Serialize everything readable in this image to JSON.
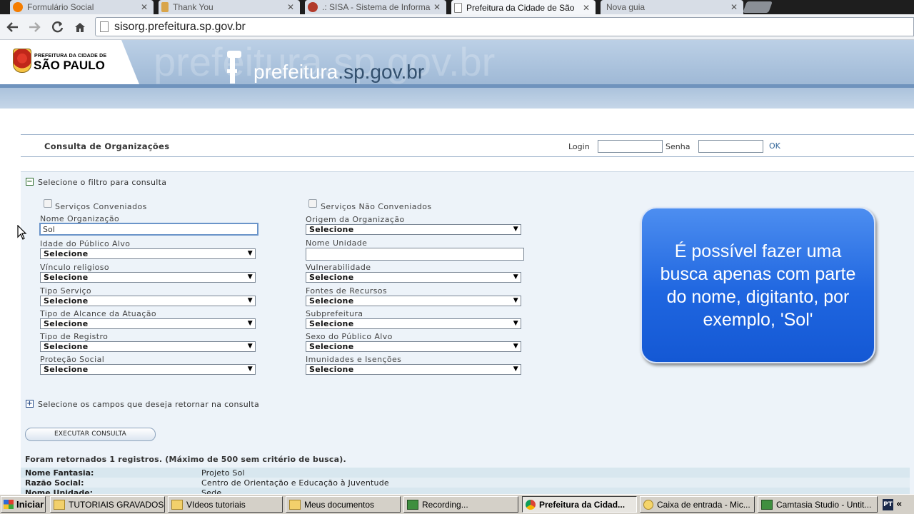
{
  "browser": {
    "tabs": [
      {
        "label": "Formulário Social",
        "active": false,
        "favicon": "blogger-icon",
        "color": "#f57d00"
      },
      {
        "label": "Thank You",
        "active": false,
        "favicon": "tool-icon",
        "color": "#d9a54a"
      },
      {
        "label": ".: SISA - Sistema de Informa",
        "active": false,
        "favicon": "sisa-icon",
        "color": "#b23a2a"
      },
      {
        "label": "Prefeitura da Cidade de São",
        "active": true,
        "favicon": "page-icon",
        "color": "#ffffff"
      },
      {
        "label": "Nova guia",
        "active": false,
        "favicon": "",
        "color": ""
      }
    ],
    "close_glyph": "✕",
    "url": "sisorg.prefeitura.sp.gov.br"
  },
  "site": {
    "logo_small": "PREFEITURA DA CIDADE DE",
    "logo_big": "SÃO PAULO",
    "watermark": "prefeitura.sp.gov.br",
    "title_main": "prefeitura",
    "title_domain": ".sp.gov.br"
  },
  "page": {
    "title": "Consulta de Organizações",
    "login_label": "Login",
    "password_label": "Senha",
    "ok_label": "OK"
  },
  "filter": {
    "collapse_glyph": "−",
    "expand_glyph": "+",
    "section_title": "Selecione o filtro para consulta",
    "checkbox_left": "Serviços Conveniados",
    "checkbox_right": "Serviços Não Conveniados",
    "left_fields": [
      {
        "label": "Nome Organização",
        "type": "text",
        "value": "Sol"
      },
      {
        "label": "Idade do Público Alvo",
        "type": "select",
        "value": "Selecione"
      },
      {
        "label": "Vínculo religioso",
        "type": "select",
        "value": "Selecione"
      },
      {
        "label": "Tipo Serviço",
        "type": "select",
        "value": "Selecione"
      },
      {
        "label": "Tipo de Alcance da Atuação",
        "type": "select",
        "value": "Selecione"
      },
      {
        "label": "Tipo de Registro",
        "type": "select",
        "value": "Selecione"
      },
      {
        "label": "Proteção Social",
        "type": "select",
        "value": "Selecione"
      }
    ],
    "right_fields": [
      {
        "label": "Origem da Organização",
        "type": "select",
        "value": "Selecione"
      },
      {
        "label": "Nome Unidade",
        "type": "text",
        "value": ""
      },
      {
        "label": "Vulnerabilidade",
        "type": "select",
        "value": "Selecione"
      },
      {
        "label": "Fontes de Recursos",
        "type": "select",
        "value": "Selecione"
      },
      {
        "label": "Subprefeitura",
        "type": "select",
        "value": "Selecione"
      },
      {
        "label": "Sexo do Público Alvo",
        "type": "select",
        "value": "Selecione"
      },
      {
        "label": "Imunidades e Isenções",
        "type": "select",
        "value": "Selecione"
      }
    ],
    "return_fields_label": "Selecione os campos que deseja retornar na consulta",
    "execute_button": "EXECUTAR CONSULTA"
  },
  "results": {
    "summary": "Foram retornados 1 registros. (Máximo de 500 sem critério de busca).",
    "rows": [
      {
        "key": "Nome Fantasia:",
        "value": "Projeto Sol"
      },
      {
        "key": "Razão Social:",
        "value": "Centro de Orientação e Educação à Juventude"
      },
      {
        "key": "Nome Unidade:",
        "value": "Sede"
      }
    ]
  },
  "callout": {
    "text": "É possível fazer uma busca apenas com parte do nome, digitanto, por exemplo, 'Sol'"
  },
  "taskbar": {
    "start_label": "Iniciar",
    "items": [
      {
        "label": "TUTORIAIS GRAVADOS",
        "icon": "folder-icon",
        "active": false
      },
      {
        "label": "VIdeos tutoriais",
        "icon": "folder-icon",
        "active": false
      },
      {
        "label": "Meus documentos",
        "icon": "folder-icon",
        "active": false
      },
      {
        "label": "Recording...",
        "icon": "camtasia-icon",
        "active": false
      },
      {
        "label": "Prefeitura da Cidad...",
        "icon": "chrome-icon",
        "active": true
      },
      {
        "label": "Caixa de entrada - Mic...",
        "icon": "outlook-icon",
        "active": false
      },
      {
        "label": "Camtasia Studio - Untit...",
        "icon": "camtasia-icon",
        "active": false
      }
    ],
    "tray_icon": "PT",
    "tray_chevron": "«"
  }
}
